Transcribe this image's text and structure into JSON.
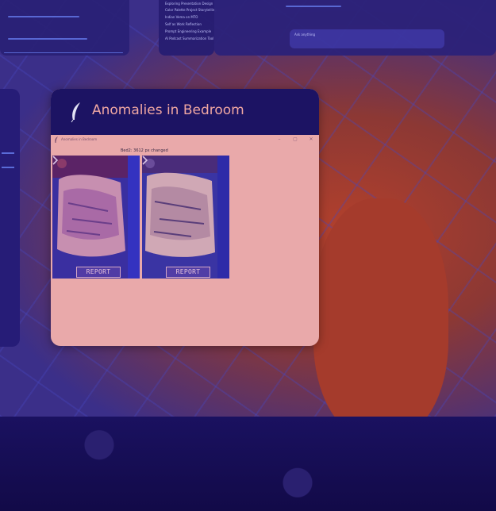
{
  "card": {
    "title": "Anomalies in Bedroom",
    "status": "Bed2: 3612 px changed",
    "titlebar_text": "Anomalies in Bedroom",
    "window_controls": {
      "minimize": "–",
      "maximize": "▢",
      "close": "✕"
    }
  },
  "feeds": [
    {
      "report_label": "REPORT",
      "variant": "previous",
      "next_icon": "chevron-right-icon"
    },
    {
      "report_label": "REPORT",
      "variant": "current",
      "next_icon": "chevron-right-icon"
    }
  ],
  "background_window": {
    "items": [
      "Exploring Presentation Design",
      "Color Palette Project Storytelling",
      "Indian Vema on MTO",
      "Self as Work Reflection",
      "Prompt Engineering Example",
      "AI Podcast Summarization Tool"
    ],
    "search_placeholder": "Ask anything"
  },
  "colors": {
    "header": "#1c1363",
    "card_body": "#e9a9aa",
    "title_text": "#f0a7a2",
    "report_border": "#d4a7c5"
  }
}
